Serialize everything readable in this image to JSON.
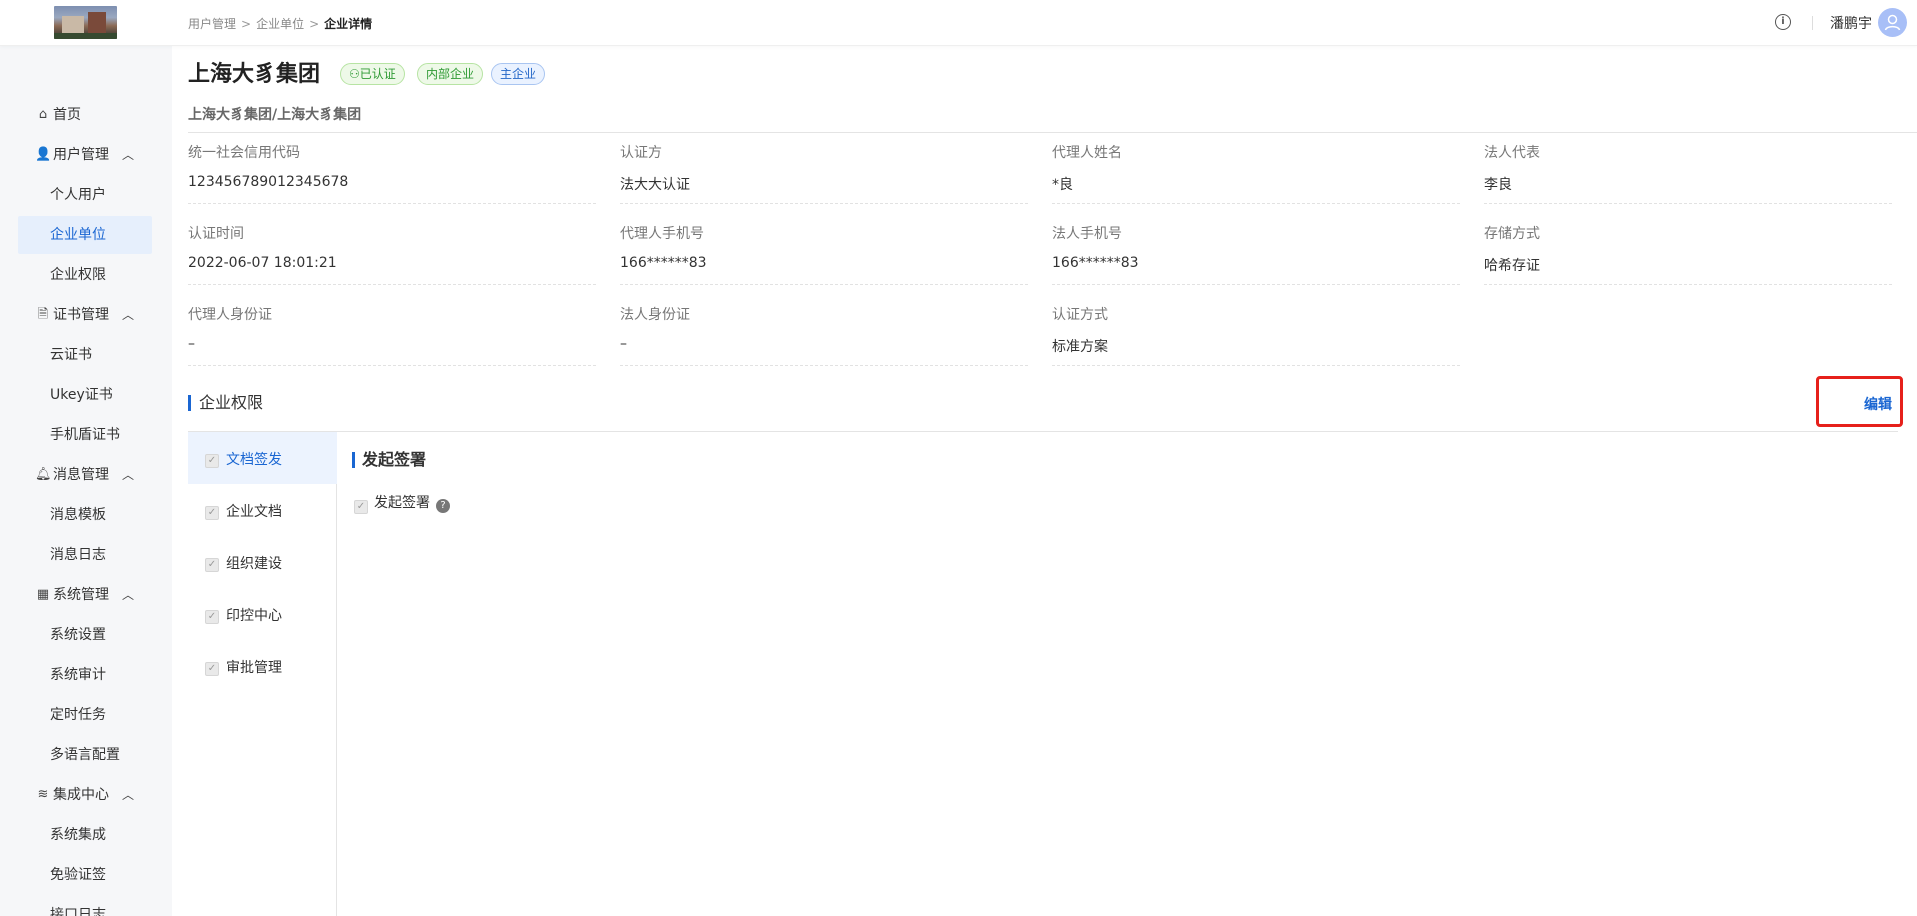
{
  "header": {
    "breadcrumb": [
      "用户管理",
      "企业单位",
      "企业详情"
    ],
    "separator": ">",
    "info_icon": "info-circle-icon",
    "username": "潘鹏宇",
    "avatar_icon": "user-icon"
  },
  "sidebar": {
    "items": [
      {
        "label": "首页",
        "type": "group",
        "icon": "home-icon"
      },
      {
        "label": "用户管理",
        "type": "group",
        "icon": "users-icon",
        "expanded": true
      },
      {
        "label": "个人用户",
        "type": "child"
      },
      {
        "label": "企业单位",
        "type": "child",
        "active": true
      },
      {
        "label": "企业权限",
        "type": "child"
      },
      {
        "label": "证书管理",
        "type": "group",
        "icon": "document-icon",
        "expanded": true
      },
      {
        "label": "云证书",
        "type": "child"
      },
      {
        "label": "Ukey证书",
        "type": "child"
      },
      {
        "label": "手机盾证书",
        "type": "child"
      },
      {
        "label": "消息管理",
        "type": "group",
        "icon": "bell-icon",
        "expanded": true
      },
      {
        "label": "消息模板",
        "type": "child"
      },
      {
        "label": "消息日志",
        "type": "child"
      },
      {
        "label": "系统管理",
        "type": "group",
        "icon": "layout-icon",
        "expanded": true
      },
      {
        "label": "系统设置",
        "type": "child"
      },
      {
        "label": "系统审计",
        "type": "child"
      },
      {
        "label": "定时任务",
        "type": "child"
      },
      {
        "label": "多语言配置",
        "type": "child"
      },
      {
        "label": "集成中心",
        "type": "group",
        "icon": "layers-icon",
        "expanded": true
      },
      {
        "label": "系统集成",
        "type": "child"
      },
      {
        "label": "免验证签",
        "type": "child"
      },
      {
        "label": "接口日志",
        "type": "child"
      }
    ]
  },
  "company": {
    "name": "上海大豸集团",
    "tags": [
      {
        "label": "已认证",
        "color": "green",
        "icon": "verified-user-icon"
      },
      {
        "label": "内部企业",
        "color": "green"
      },
      {
        "label": "主企业",
        "color": "blue"
      }
    ],
    "path": "上海大豸集团/上海大豸集团"
  },
  "details": [
    {
      "label": "统一社会信用代码",
      "value": "123456789012345678"
    },
    {
      "label": "认证方",
      "value": "法大大认证"
    },
    {
      "label": "代理人姓名",
      "value": "*良"
    },
    {
      "label": "法人代表",
      "value": "李良"
    },
    {
      "label": "认证时间",
      "value": "2022-06-07 18:01:21"
    },
    {
      "label": "代理人手机号",
      "value": "166******83"
    },
    {
      "label": "法人手机号",
      "value": "166******83"
    },
    {
      "label": "存储方式",
      "value": "哈希存证"
    },
    {
      "label": "代理人身份证",
      "value": "–"
    },
    {
      "label": "法人身份证",
      "value": "–"
    },
    {
      "label": "认证方式",
      "value": "标准方案"
    }
  ],
  "permissions": {
    "section_title": "企业权限",
    "edit_label": "编辑",
    "categories": [
      {
        "label": "文档签发",
        "checked": true,
        "active": true
      },
      {
        "label": "企业文档",
        "checked": true
      },
      {
        "label": "组织建设",
        "checked": true
      },
      {
        "label": "印控中心",
        "checked": true
      },
      {
        "label": "审批管理",
        "checked": true
      }
    ],
    "detail_title": "发起签署",
    "detail_items": [
      {
        "label": "发起签署",
        "checked": true,
        "help": "?"
      }
    ]
  },
  "colors": {
    "accent": "#1a66d2",
    "highlight": "#e6201b",
    "tag_green": "#2f9a34",
    "tag_blue": "#2467c8"
  }
}
